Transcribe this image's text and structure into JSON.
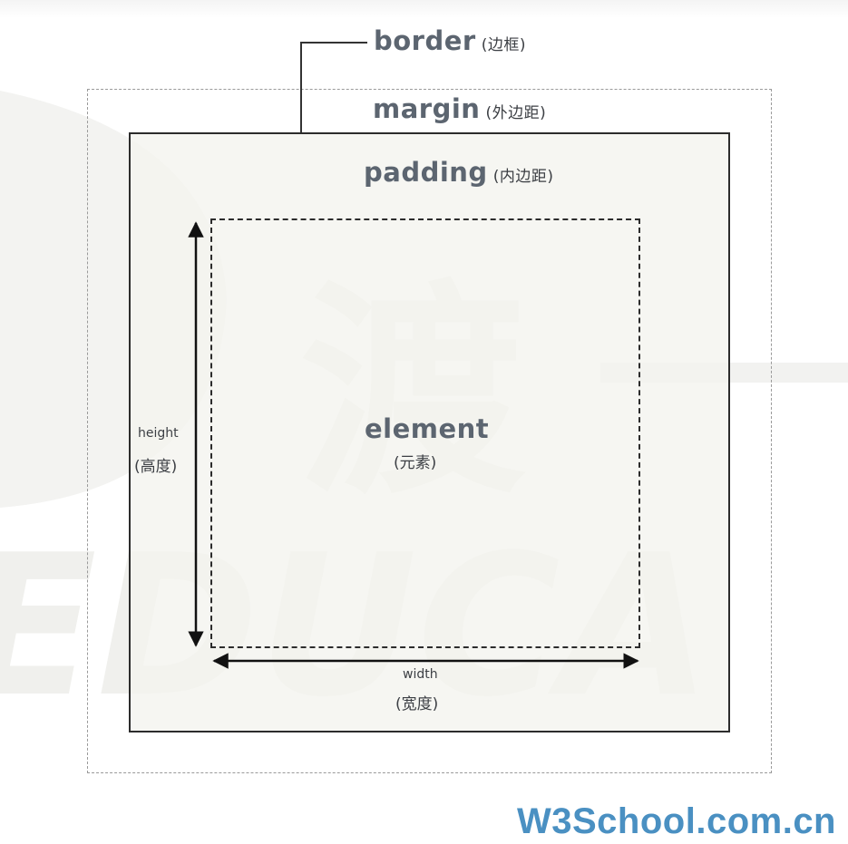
{
  "diagram": {
    "border": {
      "label": "border",
      "label_cn": "(边框)"
    },
    "margin": {
      "label": "margin",
      "label_cn": "(外边距)"
    },
    "padding": {
      "label": "padding",
      "label_cn": "(内边距)"
    },
    "element": {
      "label": "element",
      "label_cn": "(元素)"
    },
    "height": {
      "label": "height",
      "label_cn": "(高度)"
    },
    "width": {
      "label": "width",
      "label_cn": "(宽度)"
    }
  },
  "watermark": {
    "glyph": "渡",
    "text": "EDUCA"
  },
  "footer": {
    "text": "W3School.com.cn"
  },
  "colors": {
    "label": "#5c6570",
    "footer": "#4a90c2",
    "border": "#2c2c2c",
    "padding_fill": "#f3f3ee"
  }
}
